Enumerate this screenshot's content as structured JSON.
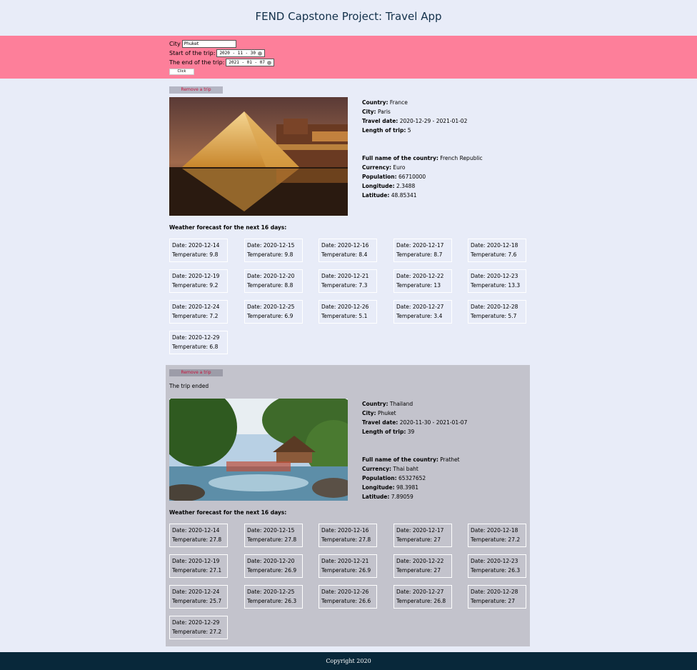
{
  "header": {
    "title": "FEND Capstone Project: Travel App"
  },
  "form": {
    "city_label": "City",
    "city_value": "Phuket",
    "start_label": "Start of the trip:",
    "start_value": "2020 - 11 - 30",
    "end_label": "The end of the trip:",
    "end_value": "2021 - 01 - 07",
    "submit_label": "Click"
  },
  "labels": {
    "country": "Country:",
    "city": "City:",
    "travel_date": "Travel date:",
    "length": "Length of trip:",
    "full_name": "Full name of the country:",
    "currency": "Currency:",
    "population": "Population:",
    "longitude": "Longitude:",
    "latitude": "Latitude:",
    "forecast_title": "Weather forecast for the next 16 days:",
    "date_prefix": "Date: ",
    "temp_prefix": "Temperature: ",
    "remove": "Remove a trip"
  },
  "trips": [
    {
      "status": "",
      "country": "France",
      "city": "Paris",
      "travel_date": "2020-12-29 - 2021-01-02",
      "length": "5",
      "full_name": "French Republic",
      "currency": "Euro",
      "population": "66710000",
      "longitude": "2.3488",
      "latitude": "48.85341",
      "forecast": [
        {
          "date": "2020-12-14",
          "temp": "9.8"
        },
        {
          "date": "2020-12-15",
          "temp": "9.8"
        },
        {
          "date": "2020-12-16",
          "temp": "8.4"
        },
        {
          "date": "2020-12-17",
          "temp": "8.7"
        },
        {
          "date": "2020-12-18",
          "temp": "7.6"
        },
        {
          "date": "2020-12-19",
          "temp": "9.2"
        },
        {
          "date": "2020-12-20",
          "temp": "8.8"
        },
        {
          "date": "2020-12-21",
          "temp": "7.3"
        },
        {
          "date": "2020-12-22",
          "temp": "13"
        },
        {
          "date": "2020-12-23",
          "temp": "13.3"
        },
        {
          "date": "2020-12-24",
          "temp": "7.2"
        },
        {
          "date": "2020-12-25",
          "temp": "6.9"
        },
        {
          "date": "2020-12-26",
          "temp": "5.1"
        },
        {
          "date": "2020-12-27",
          "temp": "3.4"
        },
        {
          "date": "2020-12-28",
          "temp": "5.7"
        },
        {
          "date": "2020-12-29",
          "temp": "6.8"
        }
      ]
    },
    {
      "status": "The trip ended",
      "country": "Thailand",
      "city": "Phuket",
      "travel_date": "2020-11-30 - 2021-01-07",
      "length": "39",
      "full_name": "Prathet",
      "currency": "Thai baht",
      "population": "65327652",
      "longitude": "98.3981",
      "latitude": "7.89059",
      "forecast": [
        {
          "date": "2020-12-14",
          "temp": "27.8"
        },
        {
          "date": "2020-12-15",
          "temp": "27.8"
        },
        {
          "date": "2020-12-16",
          "temp": "27.8"
        },
        {
          "date": "2020-12-17",
          "temp": "27"
        },
        {
          "date": "2020-12-18",
          "temp": "27.2"
        },
        {
          "date": "2020-12-19",
          "temp": "27.1"
        },
        {
          "date": "2020-12-20",
          "temp": "26.9"
        },
        {
          "date": "2020-12-21",
          "temp": "26.9"
        },
        {
          "date": "2020-12-22",
          "temp": "27"
        },
        {
          "date": "2020-12-23",
          "temp": "26.3"
        },
        {
          "date": "2020-12-24",
          "temp": "25.7"
        },
        {
          "date": "2020-12-25",
          "temp": "26.3"
        },
        {
          "date": "2020-12-26",
          "temp": "26.6"
        },
        {
          "date": "2020-12-27",
          "temp": "26.8"
        },
        {
          "date": "2020-12-28",
          "temp": "27"
        },
        {
          "date": "2020-12-29",
          "temp": "27.2"
        }
      ]
    }
  ],
  "footer": {
    "text": "Copyright 2020"
  }
}
